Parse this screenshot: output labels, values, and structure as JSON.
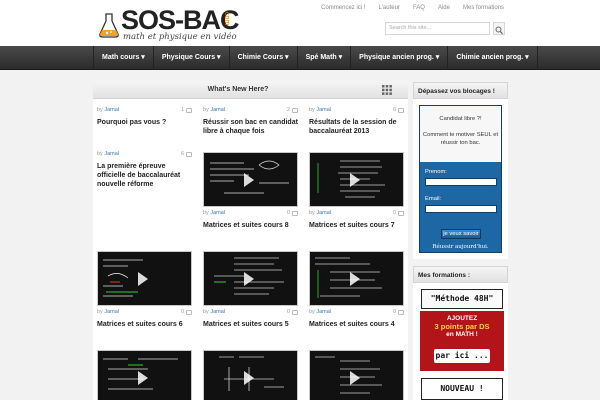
{
  "header": {
    "logo_text": "SOS-BAC",
    "logo_tagline": "math et physique en vidéo",
    "logo_suffix": ".com",
    "top_links": [
      "Commencez ici !",
      "L'auteur",
      "FAQ",
      "Aide",
      "Mes formations"
    ],
    "search_placeholder": "Search this site..."
  },
  "nav": {
    "items": [
      "Math cours",
      "Physique Cours",
      "Chimie Cours",
      "Spé Math",
      "Physique ancien prog.",
      "Chimie ancien prog."
    ]
  },
  "main": {
    "title": "What's New Here?",
    "posts": [
      {
        "by": "by",
        "author": "Jamal",
        "comments": "1",
        "title": "Pourquoi pas vous ?"
      },
      {
        "by": "by",
        "author": "Jamal",
        "comments": "2",
        "title": "Réussir son bac en candidat libre à chaque fois"
      },
      {
        "by": "by",
        "author": "Jamal",
        "comments": "6",
        "title": "Résultats de la session de baccalauréat 2013"
      },
      {
        "by": "by",
        "author": "Jamal",
        "comments": "6",
        "title": "La première épreuve officielle de baccalauréat nouvelle réforme"
      },
      {
        "by": "by",
        "author": "Jamal",
        "comments": "0",
        "title": "Matrices et suites cours 8"
      },
      {
        "by": "by",
        "author": "Jamal",
        "comments": "0",
        "title": "Matrices et suites cours 7"
      },
      {
        "by": "by",
        "author": "Jamal",
        "comments": "0",
        "title": "Matrices et suites cours 6"
      },
      {
        "by": "by",
        "author": "Jamal",
        "comments": "0",
        "title": "Matrices et suites cours 5"
      },
      {
        "by": "by",
        "author": "Jamal",
        "comments": "0",
        "title": "Matrices et suites cours 4"
      },
      {
        "by": "",
        "author": "",
        "comments": "",
        "title": ""
      },
      {
        "by": "",
        "author": "",
        "comments": "",
        "title": ""
      },
      {
        "by": "",
        "author": "",
        "comments": "",
        "title": ""
      }
    ]
  },
  "sidebar": {
    "blocages_title": "Dépassez vos blocages !",
    "optin_line1": "Candidat libre ?!",
    "optin_line2": "Comment te motiver SEUL et réussir ton bac.",
    "prenom_label": "Prenom:",
    "email_label": "Email:",
    "button_label": "je veux savoir",
    "footer_text": "Réussir aujourd'hui.",
    "formations_title": "Mes formations :",
    "promo_top": "\"Méthode 48H\"",
    "promo_l1": "AJOUTEZ",
    "promo_l2": "3 points par DS",
    "promo_l3": "en MATH !",
    "promo_cta": "par ici ...",
    "promo2": "NOUVEAU !"
  },
  "colors": {
    "nav_bg": "#2f2f2f",
    "author_link": "#3a77b5",
    "optin_bg": "#1d67a5",
    "promo_red": "#b3141a",
    "logo_accent": "#e17b15"
  }
}
